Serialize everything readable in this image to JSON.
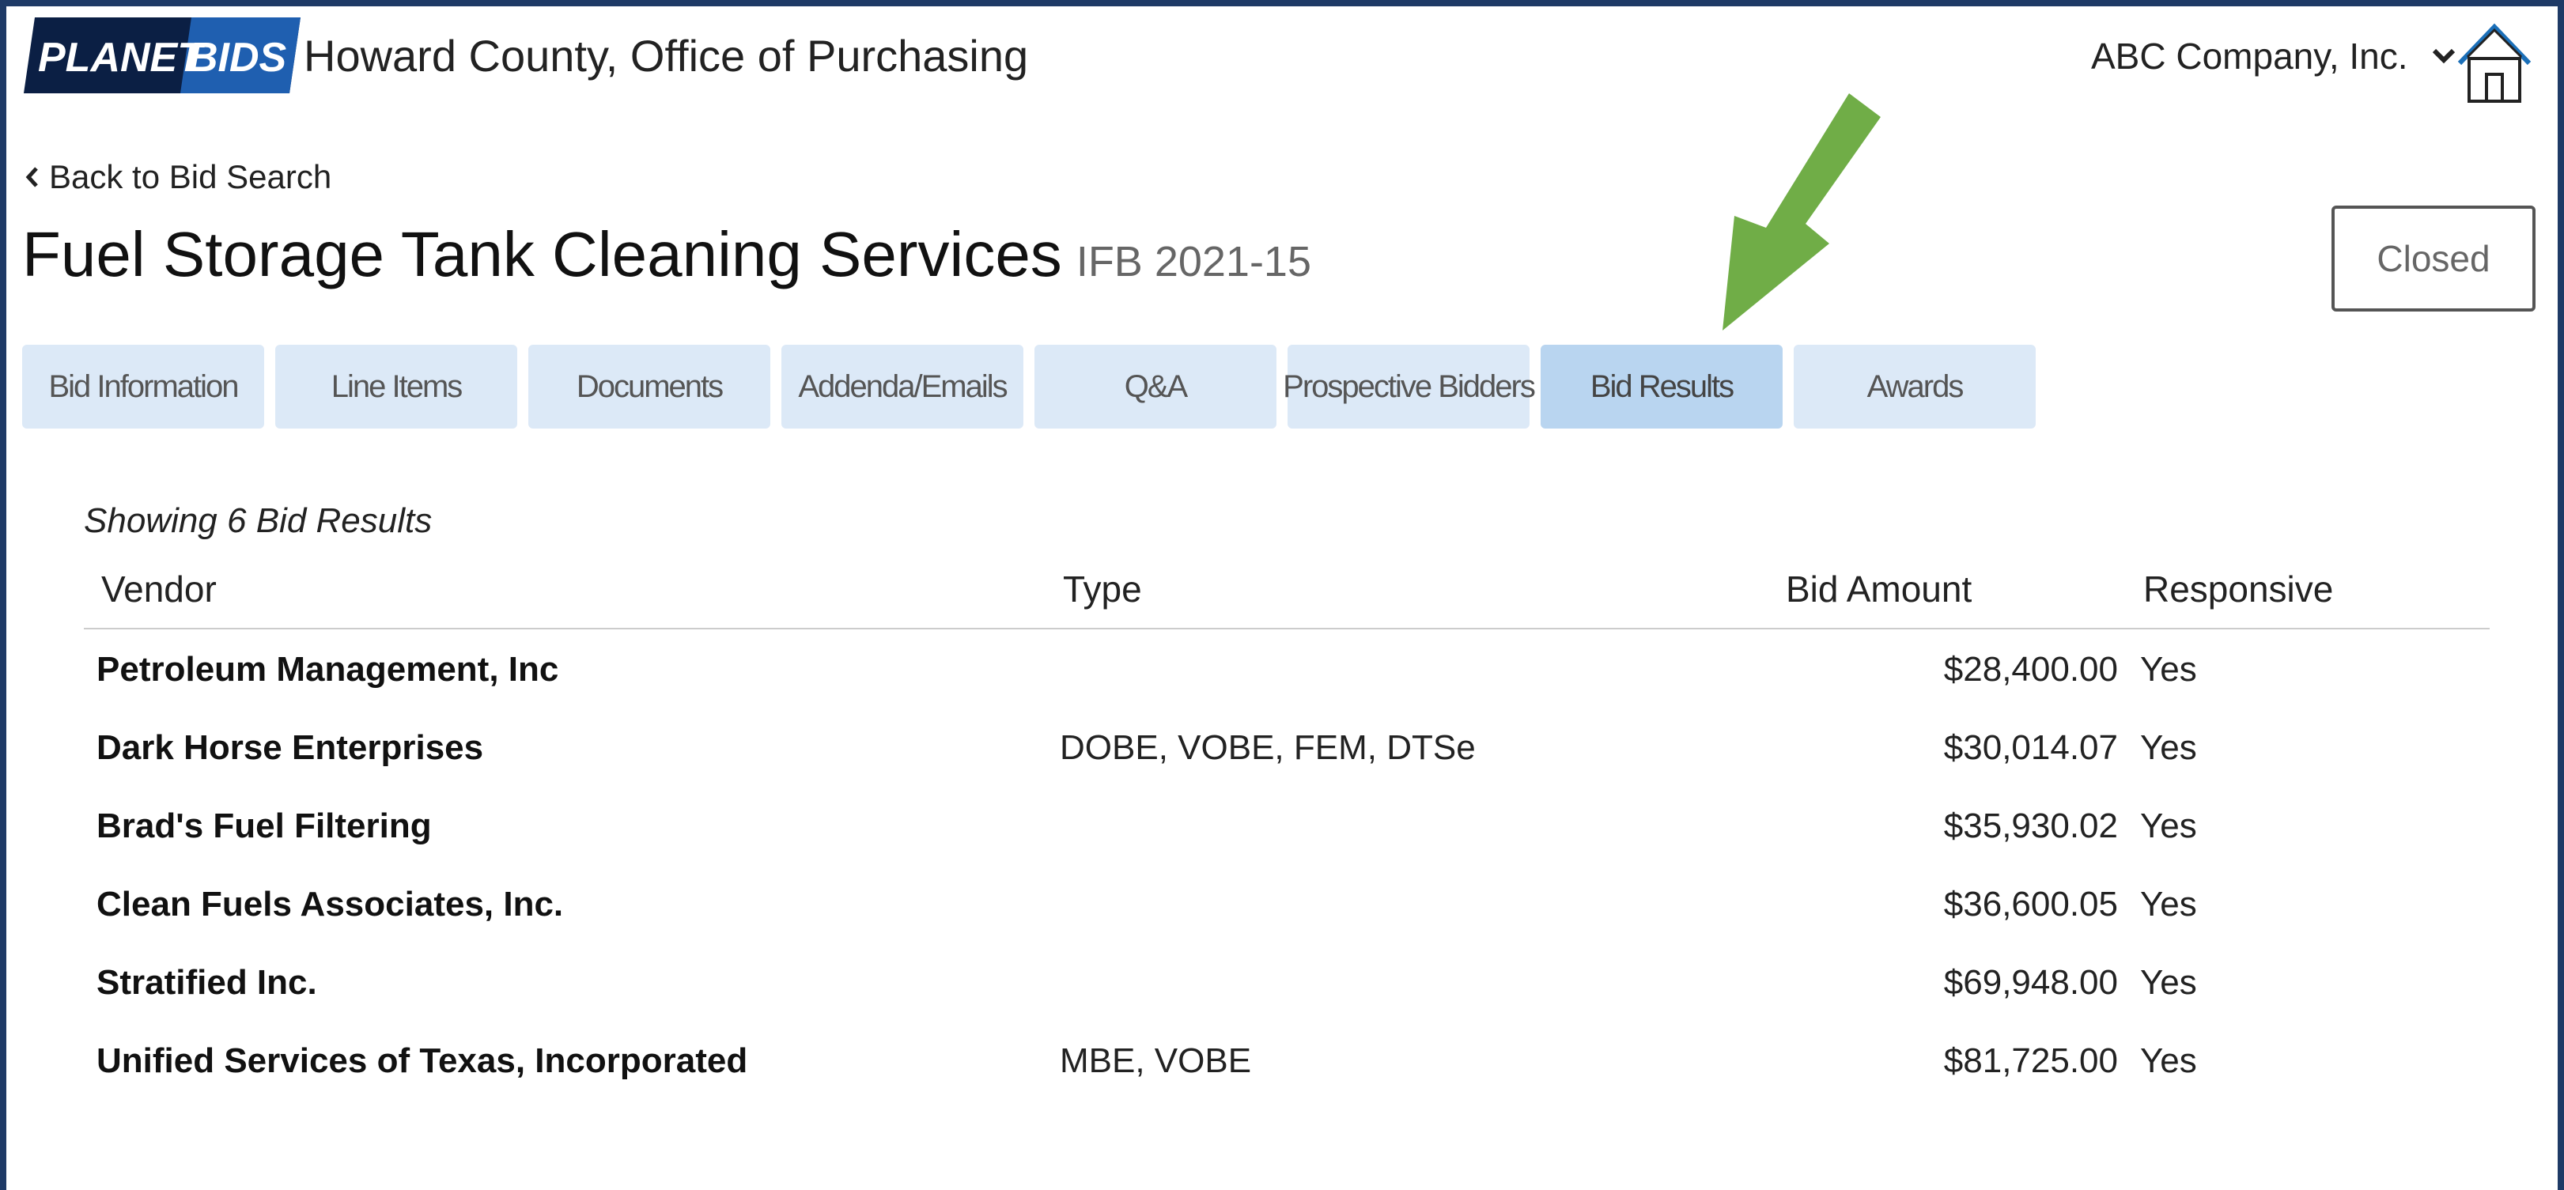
{
  "header": {
    "logo_text_left": "PLANET",
    "logo_text_right": "BIDS",
    "org_name": "Howard County, Office of Purchasing",
    "company_menu": "ABC Company, Inc.",
    "home_icon": "home-icon"
  },
  "nav": {
    "back_label": "Back to Bid Search"
  },
  "bid": {
    "title": "Fuel Storage Tank Cleaning Services",
    "number": "IFB 2021-15",
    "status": "Closed"
  },
  "tabs": [
    {
      "label": "Bid Information"
    },
    {
      "label": "Line Items"
    },
    {
      "label": "Documents"
    },
    {
      "label": "Addenda/Emails"
    },
    {
      "label": "Q&A"
    },
    {
      "label": "Prospective Bidders"
    },
    {
      "label": "Bid Results",
      "active": true
    },
    {
      "label": "Awards"
    }
  ],
  "results": {
    "summary": "Showing 6 Bid Results",
    "columns": {
      "vendor": "Vendor",
      "type": "Type",
      "amount": "Bid Amount",
      "responsive": "Responsive"
    },
    "rows": [
      {
        "vendor": "Petroleum Management, Inc",
        "type": "",
        "amount": "$28,400.00",
        "responsive": "Yes"
      },
      {
        "vendor": "Dark Horse Enterprises",
        "type": "DOBE, VOBE, FEM, DTSe",
        "amount": "$30,014.07",
        "responsive": "Yes"
      },
      {
        "vendor": "Brad's Fuel Filtering",
        "type": "",
        "amount": "$35,930.02",
        "responsive": "Yes"
      },
      {
        "vendor": "Clean Fuels Associates, Inc.",
        "type": "",
        "amount": "$36,600.05",
        "responsive": "Yes"
      },
      {
        "vendor": "Stratified Inc.",
        "type": "",
        "amount": "$69,948.00",
        "responsive": "Yes"
      },
      {
        "vendor": "Unified Services of Texas, Incorporated",
        "type": "MBE, VOBE",
        "amount": "$81,725.00",
        "responsive": "Yes"
      }
    ]
  },
  "colors": {
    "frame": "#1e3a66",
    "tab_bg": "#dce9f7",
    "tab_active_bg": "#b9d5f0",
    "annotation_arrow": "#70ad47",
    "logo_bg": "#0b1f44",
    "logo_accent": "#3d8fe0"
  }
}
